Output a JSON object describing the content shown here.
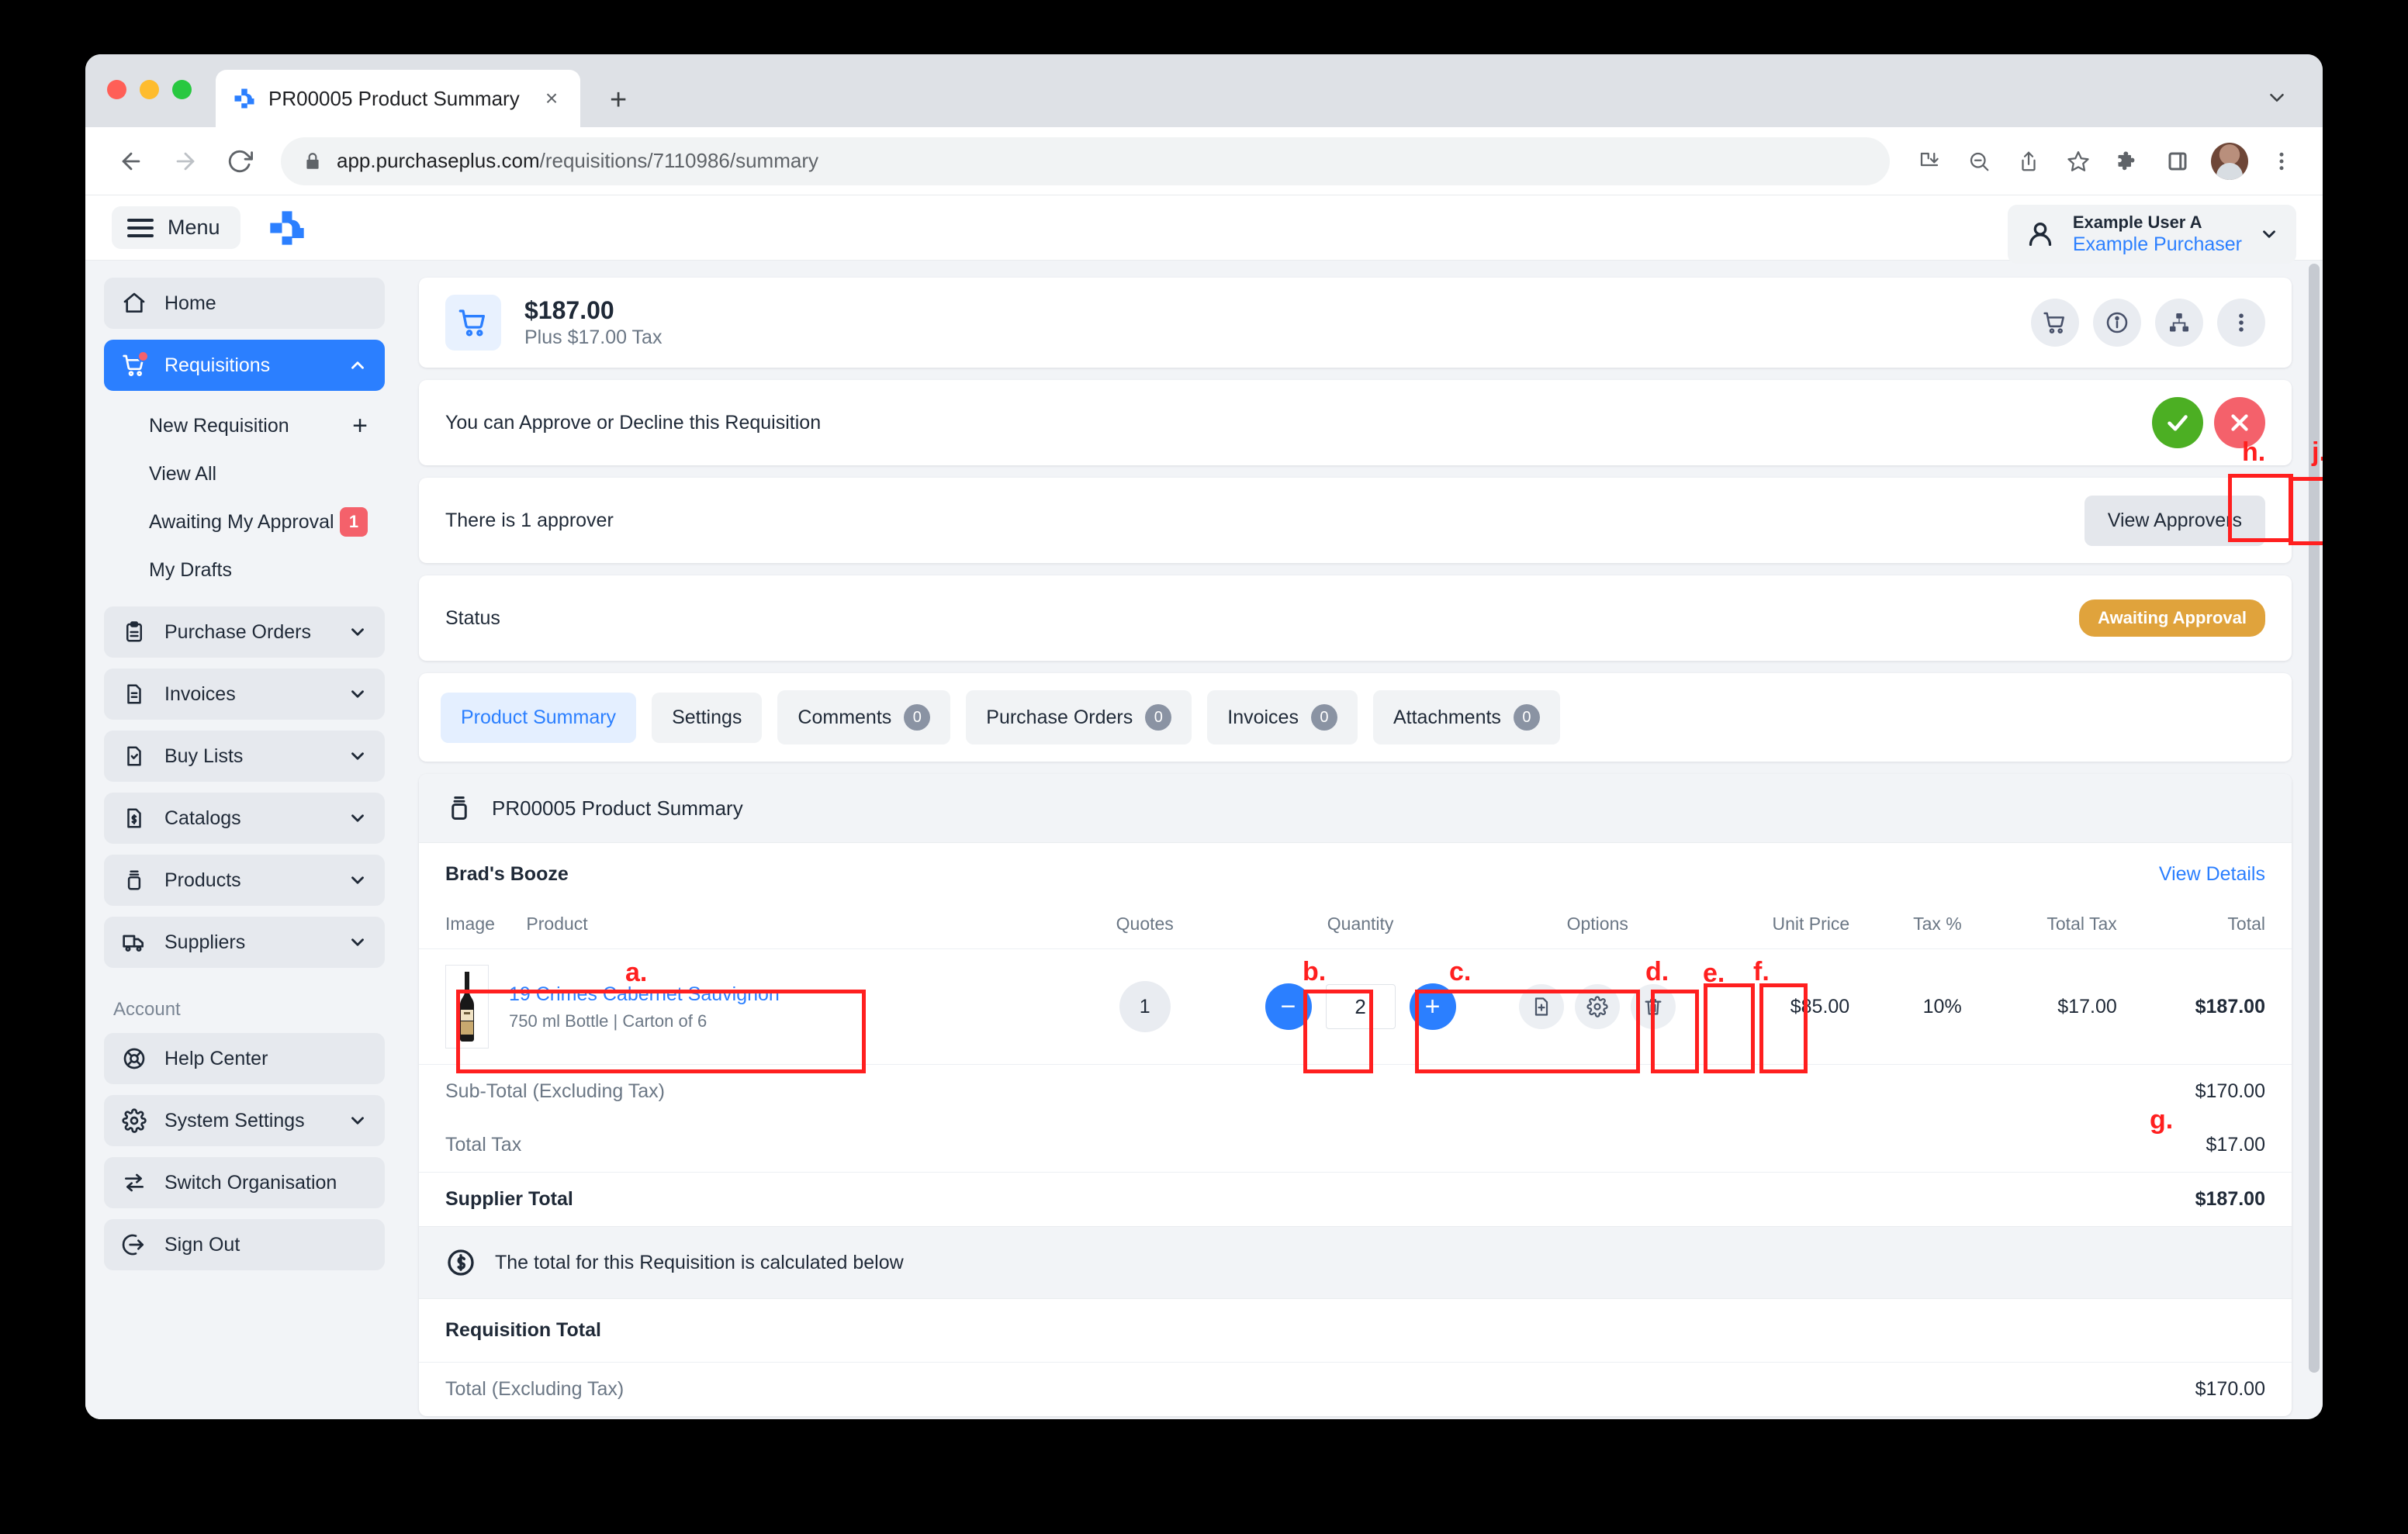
{
  "browser": {
    "tab_title": "PR00005 Product Summary",
    "tab_close": "×",
    "new_tab": "+",
    "url_host": "app.purchaseplus.com",
    "url_path": "/requisitions/7110986/summary"
  },
  "app_header": {
    "menu_label": "Menu",
    "user_name": "Example User A",
    "user_role": "Example Purchaser"
  },
  "sidebar": {
    "items": [
      {
        "label": "Home",
        "icon": "home-icon",
        "expandable": false
      },
      {
        "label": "Requisitions",
        "icon": "cart-icon",
        "expandable": true,
        "active": true
      },
      {
        "label": "Purchase Orders",
        "icon": "clipboard-icon",
        "expandable": true
      },
      {
        "label": "Invoices",
        "icon": "document-icon",
        "expandable": true
      },
      {
        "label": "Buy Lists",
        "icon": "document-check-icon",
        "expandable": true
      },
      {
        "label": "Catalogs",
        "icon": "document-dollar-icon",
        "expandable": true
      },
      {
        "label": "Products",
        "icon": "jar-icon",
        "expandable": true
      },
      {
        "label": "Suppliers",
        "icon": "truck-icon",
        "expandable": true
      }
    ],
    "sub_items": [
      {
        "label": "New Requisition",
        "trailing": "+"
      },
      {
        "label": "View All",
        "trailing": ""
      },
      {
        "label": "Awaiting My Approval",
        "trailing": "1"
      },
      {
        "label": "My Drafts",
        "trailing": ""
      }
    ],
    "account_label": "Account",
    "account_items": [
      {
        "label": "Help Center",
        "icon": "lifebuoy-icon",
        "expandable": false
      },
      {
        "label": "System Settings",
        "icon": "gear-icon",
        "expandable": true
      },
      {
        "label": "Switch Organisation",
        "icon": "switch-icon",
        "expandable": false
      },
      {
        "label": "Sign Out",
        "icon": "sign-out-icon",
        "expandable": false
      }
    ]
  },
  "summary_card": {
    "total": "$187.00",
    "tax_note": "Plus $17.00 Tax",
    "actions": [
      "cart-icon",
      "info-icon",
      "hierarchy-icon",
      "more-vertical-icon"
    ]
  },
  "approval_row": {
    "message": "You can Approve or Decline this Requisition",
    "approve_icon": "check-icon",
    "decline_icon": "close-icon"
  },
  "approver_row": {
    "message": "There is 1 approver",
    "button": "View Approvers"
  },
  "status_row": {
    "label": "Status",
    "badge": "Awaiting Approval"
  },
  "tabs": [
    {
      "label": "Product Summary",
      "count": null,
      "active": true
    },
    {
      "label": "Settings",
      "count": null
    },
    {
      "label": "Comments",
      "count": "0"
    },
    {
      "label": "Purchase Orders",
      "count": "0"
    },
    {
      "label": "Invoices",
      "count": "0"
    },
    {
      "label": "Attachments",
      "count": "0"
    }
  ],
  "content": {
    "heading": "PR00005 Product Summary",
    "supplier_name": "Brad's Booze",
    "view_details": "View Details",
    "columns": [
      "Image",
      "Product",
      "Quotes",
      "Quantity",
      "Options",
      "Unit Price",
      "Tax %",
      "Total Tax",
      "Total"
    ],
    "rows": [
      {
        "product_name": "19 Crimes Cabernet Sauvignon",
        "product_meta": "750 ml Bottle | Carton of 6",
        "quotes": "1",
        "quantity": "2",
        "qty_minus": "−",
        "qty_plus": "+",
        "unit_price": "$85.00",
        "tax_percent": "10%",
        "total_tax": "$17.00",
        "total": "$187.00"
      }
    ],
    "totals": [
      {
        "label": "Sub-Total (Excluding Tax)",
        "value": "$170.00",
        "bold": false
      },
      {
        "label": "Total Tax",
        "value": "$17.00",
        "bold": false
      },
      {
        "label": "Supplier Total",
        "value": "$187.00",
        "bold": true
      }
    ],
    "calc_note": "The total for this Requisition is calculated below",
    "requisition_total_label": "Requisition Total",
    "final_totals": [
      {
        "label": "Total (Excluding Tax)",
        "value": "$170.00"
      }
    ]
  },
  "annotations": [
    {
      "id": "a.",
      "target": "product-cell"
    },
    {
      "id": "b.",
      "target": "quotes-cell"
    },
    {
      "id": "c.",
      "target": "quantity-cell"
    },
    {
      "id": "d.",
      "target": "add-note-button"
    },
    {
      "id": "e.",
      "target": "options-gear-button"
    },
    {
      "id": "f.",
      "target": "delete-button"
    },
    {
      "id": "g.",
      "target": "totals-columns"
    },
    {
      "id": "h.",
      "target": "approve-button"
    },
    {
      "id": "j.",
      "target": "decline-button"
    }
  ],
  "accent_colors": {
    "brand_blue": "#2b7fff",
    "approve_green": "#4caf23",
    "decline_red": "#f4616b",
    "status_amber": "#e0a33c",
    "annotation_red": "#ff1f1f"
  }
}
